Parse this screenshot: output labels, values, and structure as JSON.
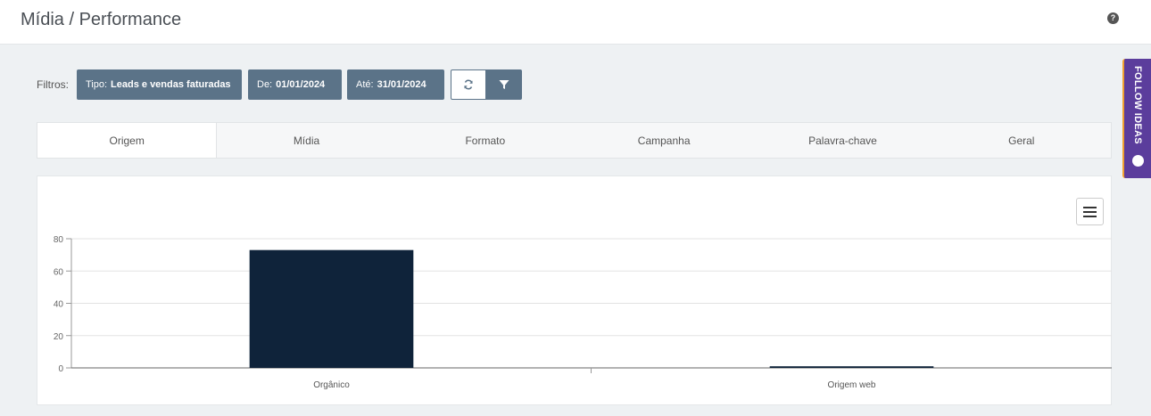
{
  "header": {
    "title": "Mídia / Performance",
    "help_icon": "question-circle-icon"
  },
  "filters": {
    "label": "Filtros:",
    "tipo_key": "Tipo:",
    "tipo_value": "Leads e vendas faturadas",
    "de_key": "De:",
    "de_value": "01/01/2024",
    "ate_key": "Até:",
    "ate_value": "31/01/2024",
    "refresh_icon": "refresh-icon",
    "filter_icon": "filter-icon"
  },
  "tabs": [
    {
      "label": "Origem",
      "active": true
    },
    {
      "label": "Mídia"
    },
    {
      "label": "Formato"
    },
    {
      "label": "Campanha"
    },
    {
      "label": "Palavra-chave"
    },
    {
      "label": "Geral"
    }
  ],
  "side_tab": {
    "label": "FOLLOW IDEAS"
  },
  "colors": {
    "chip": "#5b7388",
    "bar": "#0f233a",
    "side_tab": "#5b3d9c"
  },
  "chart_data": {
    "type": "bar",
    "categories": [
      "Orgânico",
      "Origem web"
    ],
    "values": [
      73,
      1
    ],
    "ylim": [
      0,
      80
    ],
    "yticks": [
      0,
      20,
      40,
      60,
      80
    ],
    "grid": true,
    "legend": "none"
  }
}
